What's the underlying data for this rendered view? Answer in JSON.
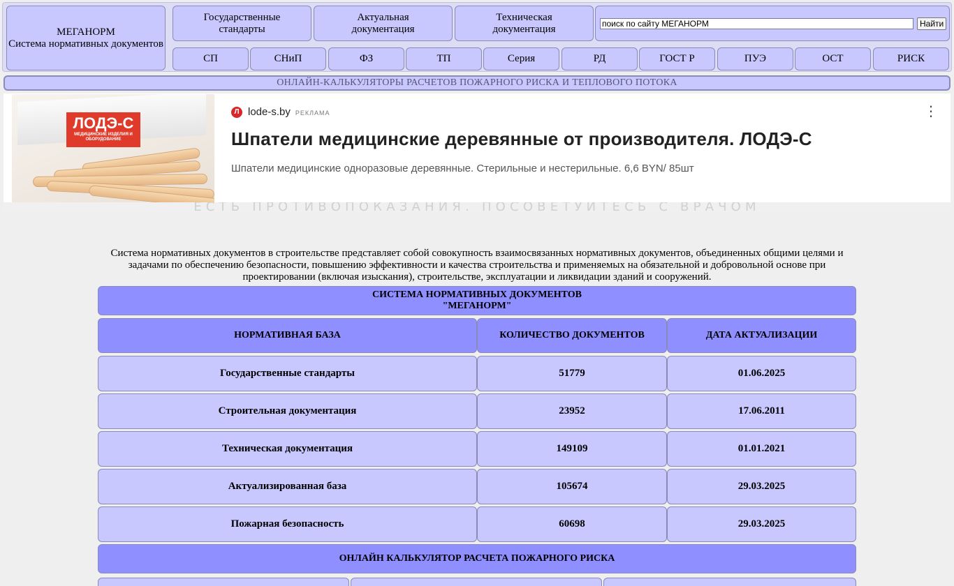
{
  "header": {
    "logo_title": "МЕГАНОРМ",
    "logo_subtitle": "Система нормативных документов",
    "top_nav": [
      {
        "line1": "Государственные",
        "line2": "стандарты"
      },
      {
        "line1": "Актуальная",
        "line2": "документация"
      },
      {
        "line1": "Техническая",
        "line2": "документация"
      }
    ],
    "search": {
      "value": "поиск по сайту МЕГАНОРМ",
      "button": "Найти"
    },
    "sub_nav": [
      "СП",
      "СНиП",
      "ФЗ",
      "ТП",
      "Серия",
      "РД",
      "ГОСТ Р",
      "ПУЭ",
      "ОСТ",
      "РИСК"
    ]
  },
  "banner": "ОНЛАЙН-КАЛЬКУЛЯТОРЫ РАСЧЕТОВ ПОЖАРНОГО РИСКА И ТЕПЛОВОГО ПОТОКА",
  "ad": {
    "logo": "ЛОДЭ-С",
    "logo_sub": "МЕДИЦИНСКИЕ ИЗДЕЛИЯ И ОБОРУДОВАНИЕ",
    "favicon": "Л",
    "domain": "lode-s.by",
    "label": "РЕКЛАМА",
    "title": "Шпатели медицинские деревянные от производителя. ЛОДЭ-С",
    "description": "Шпатели медицинские одноразовые деревянные. Стерильные и нестерильные. 6,6 BYN/ 85шт",
    "warning": "ЕСТЬ ПРОТИВОПОКАЗАНИЯ. ПОСОВЕТУЙТЕСЬ С ВРАЧОМ",
    "menu_icon": "more-vertical-icon"
  },
  "intro": "Система нормативных документов в строительстве представляет собой совокупность взаимосвязанных нормативных документов, объединенных общими целями и задачами по обеспечению безопасности, повышению эффективности и качества строительства и применяемых на обязательной и добровольной основе при проектировании (включая изыскания), строительстве, эксплуатации и ликвидации зданий и сооружений.",
  "table": {
    "title_line1": "СИСТЕМА НОРМАТИВНЫХ ДОКУМЕНТОВ",
    "title_line2": "\"МЕГАНОРМ\"",
    "headers": [
      "НОРМАТИВНАЯ БАЗА",
      "КОЛИЧЕСТВО ДОКУМЕНТОВ",
      "ДАТА АКТУАЛИЗАЦИИ"
    ],
    "rows": [
      {
        "name": "Государственные стандарты",
        "count": "51779",
        "date": "01.06.2025"
      },
      {
        "name": "Строительная документация",
        "count": "23952",
        "date": "17.06.2011"
      },
      {
        "name": "Техническая документация",
        "count": "149109",
        "date": "01.01.2021"
      },
      {
        "name": "Актуализированная база",
        "count": "105674",
        "date": "29.03.2025"
      },
      {
        "name": "Пожарная безопасность",
        "count": "60698",
        "date": "29.03.2025"
      }
    ]
  },
  "calc": {
    "header": "ОНЛАЙН КАЛЬКУЛЯТОР РАСЧЕТА ПОЖАРНОГО РИСКА"
  },
  "colors": {
    "cell": "#c8c8ff",
    "cell_dark": "#8f8fff",
    "background": "#efefef",
    "ad_red": "#e03a2a"
  }
}
